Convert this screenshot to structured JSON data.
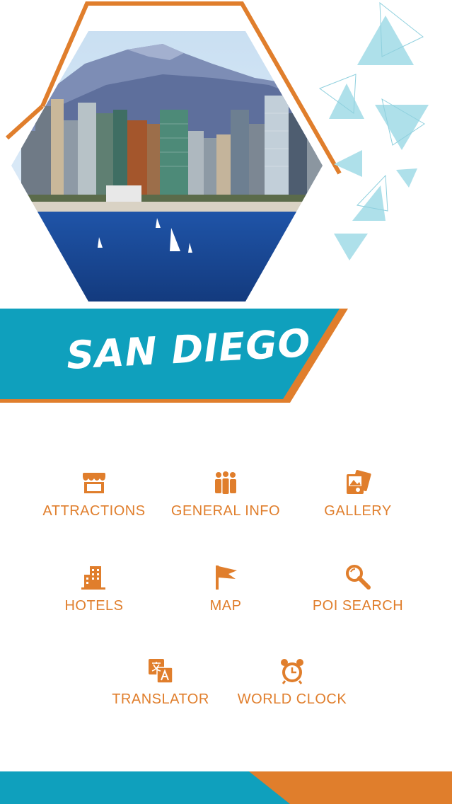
{
  "header": {
    "app_title": "SAN DIEGO",
    "hero_image": "san-diego-skyline-hexagon"
  },
  "colors": {
    "teal": "#0fa0bd",
    "orange": "#e07e2c",
    "light_teal": "#aee0ea",
    "white": "#ffffff"
  },
  "menu": {
    "attractions": {
      "label": "ATTRACTIONS",
      "icon": "storefront-icon"
    },
    "general_info": {
      "label": "GENERAL INFO",
      "icon": "people-icon"
    },
    "gallery": {
      "label": "GALLERY",
      "icon": "photos-icon"
    },
    "hotels": {
      "label": "HOTELS",
      "icon": "building-icon"
    },
    "map": {
      "label": "MAP",
      "icon": "flag-icon"
    },
    "poi_search": {
      "label": "POI SEARCH",
      "icon": "magnifier-icon"
    },
    "translator": {
      "label": "TRANSLATOR",
      "icon": "translate-icon"
    },
    "world_clock": {
      "label": "WORLD CLOCK",
      "icon": "alarm-clock-icon"
    }
  }
}
